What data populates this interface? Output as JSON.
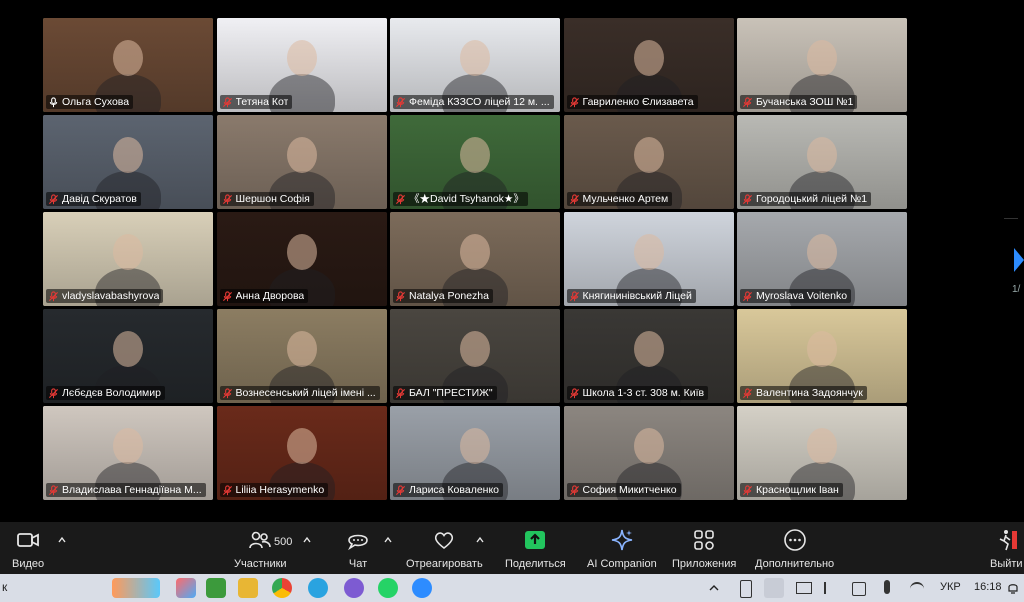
{
  "gallery": {
    "page_indicator": "1/",
    "tiles": [
      {
        "name": "Ольга Сухова",
        "muted": false,
        "active": true,
        "bg": "#6b4a35"
      },
      {
        "name": "Тетяна Кот",
        "muted": true,
        "active": false,
        "bg": "#f0f0f4"
      },
      {
        "name": "Феміда КЗЗСО ліцей 12 м. ...",
        "muted": true,
        "active": false,
        "bg": "#e8eaee"
      },
      {
        "name": "Гавриленко Єлизавета",
        "muted": true,
        "active": false,
        "bg": "#3a2e28"
      },
      {
        "name": "Бучанська ЗОШ №1",
        "muted": true,
        "active": false,
        "bg": "#c9c2b8"
      },
      {
        "name": "Давід Скуратов",
        "muted": true,
        "active": false,
        "bg": "#5c6470"
      },
      {
        "name": "Шершон Софія",
        "muted": true,
        "active": false,
        "bg": "#8a7a6c"
      },
      {
        "name": "《★David Tsyhanok★》",
        "muted": true,
        "active": false,
        "bg": "#3f6a3a"
      },
      {
        "name": "Мульченко Артем",
        "muted": true,
        "active": false,
        "bg": "#6a5a4c"
      },
      {
        "name": "Городоцький ліцей №1",
        "muted": true,
        "active": false,
        "bg": "#b9b9b4"
      },
      {
        "name": "vladyslavabashyrova",
        "muted": true,
        "active": false,
        "bg": "#d8cfb8"
      },
      {
        "name": "Анна Дворова",
        "muted": true,
        "active": false,
        "bg": "#2a1a14"
      },
      {
        "name": "Natalya  Ponezha",
        "muted": true,
        "active": false,
        "bg": "#7c6b5a"
      },
      {
        "name": "Княгининівський Ліцей",
        "muted": true,
        "active": false,
        "bg": "#cfd4dc"
      },
      {
        "name": "Myroslava Voitenko",
        "muted": true,
        "active": false,
        "bg": "#a6a9ad"
      },
      {
        "name": "Лєбєдєв Володимир",
        "muted": true,
        "active": false,
        "bg": "#262a2e"
      },
      {
        "name": "Вознесенський ліцей імені ...",
        "muted": true,
        "active": false,
        "bg": "#8c7d62"
      },
      {
        "name": "БАЛ \"ПРЕСТИЖ\"",
        "muted": true,
        "active": false,
        "bg": "#4a4640"
      },
      {
        "name": "Школа 1-3 ст. 308 м. Київ",
        "muted": true,
        "active": false,
        "bg": "#3a3835"
      },
      {
        "name": "Валентина Задоянчук",
        "muted": true,
        "active": false,
        "bg": "#d9c89a"
      },
      {
        "name": "Владислава Геннадіївна М...",
        "muted": true,
        "active": false,
        "bg": "#cfc7bf"
      },
      {
        "name": "Liliia Herasymenko",
        "muted": true,
        "active": false,
        "bg": "#6a2a1a"
      },
      {
        "name": "Лариса Коваленко",
        "muted": true,
        "active": false,
        "bg": "#9aa0a8"
      },
      {
        "name": "София Микитченко",
        "muted": true,
        "active": false,
        "bg": "#8c8680"
      },
      {
        "name": "Краснощлик Іван",
        "muted": true,
        "active": false,
        "bg": "#d4d0c6"
      }
    ]
  },
  "toolbar": {
    "video_label": "Видео",
    "participants_label": "Участники",
    "participants_count": "500",
    "chat_label": "Чат",
    "react_label": "Отреагировать",
    "share_label": "Поделиться",
    "ai_label": "AI Companion",
    "apps_label": "Приложения",
    "more_label": "Дополнительно",
    "exit_label": "Выйти",
    "share_color": "#22c55e"
  },
  "taskbar": {
    "left_char": "к",
    "language": "УКР",
    "time": "16:18"
  }
}
